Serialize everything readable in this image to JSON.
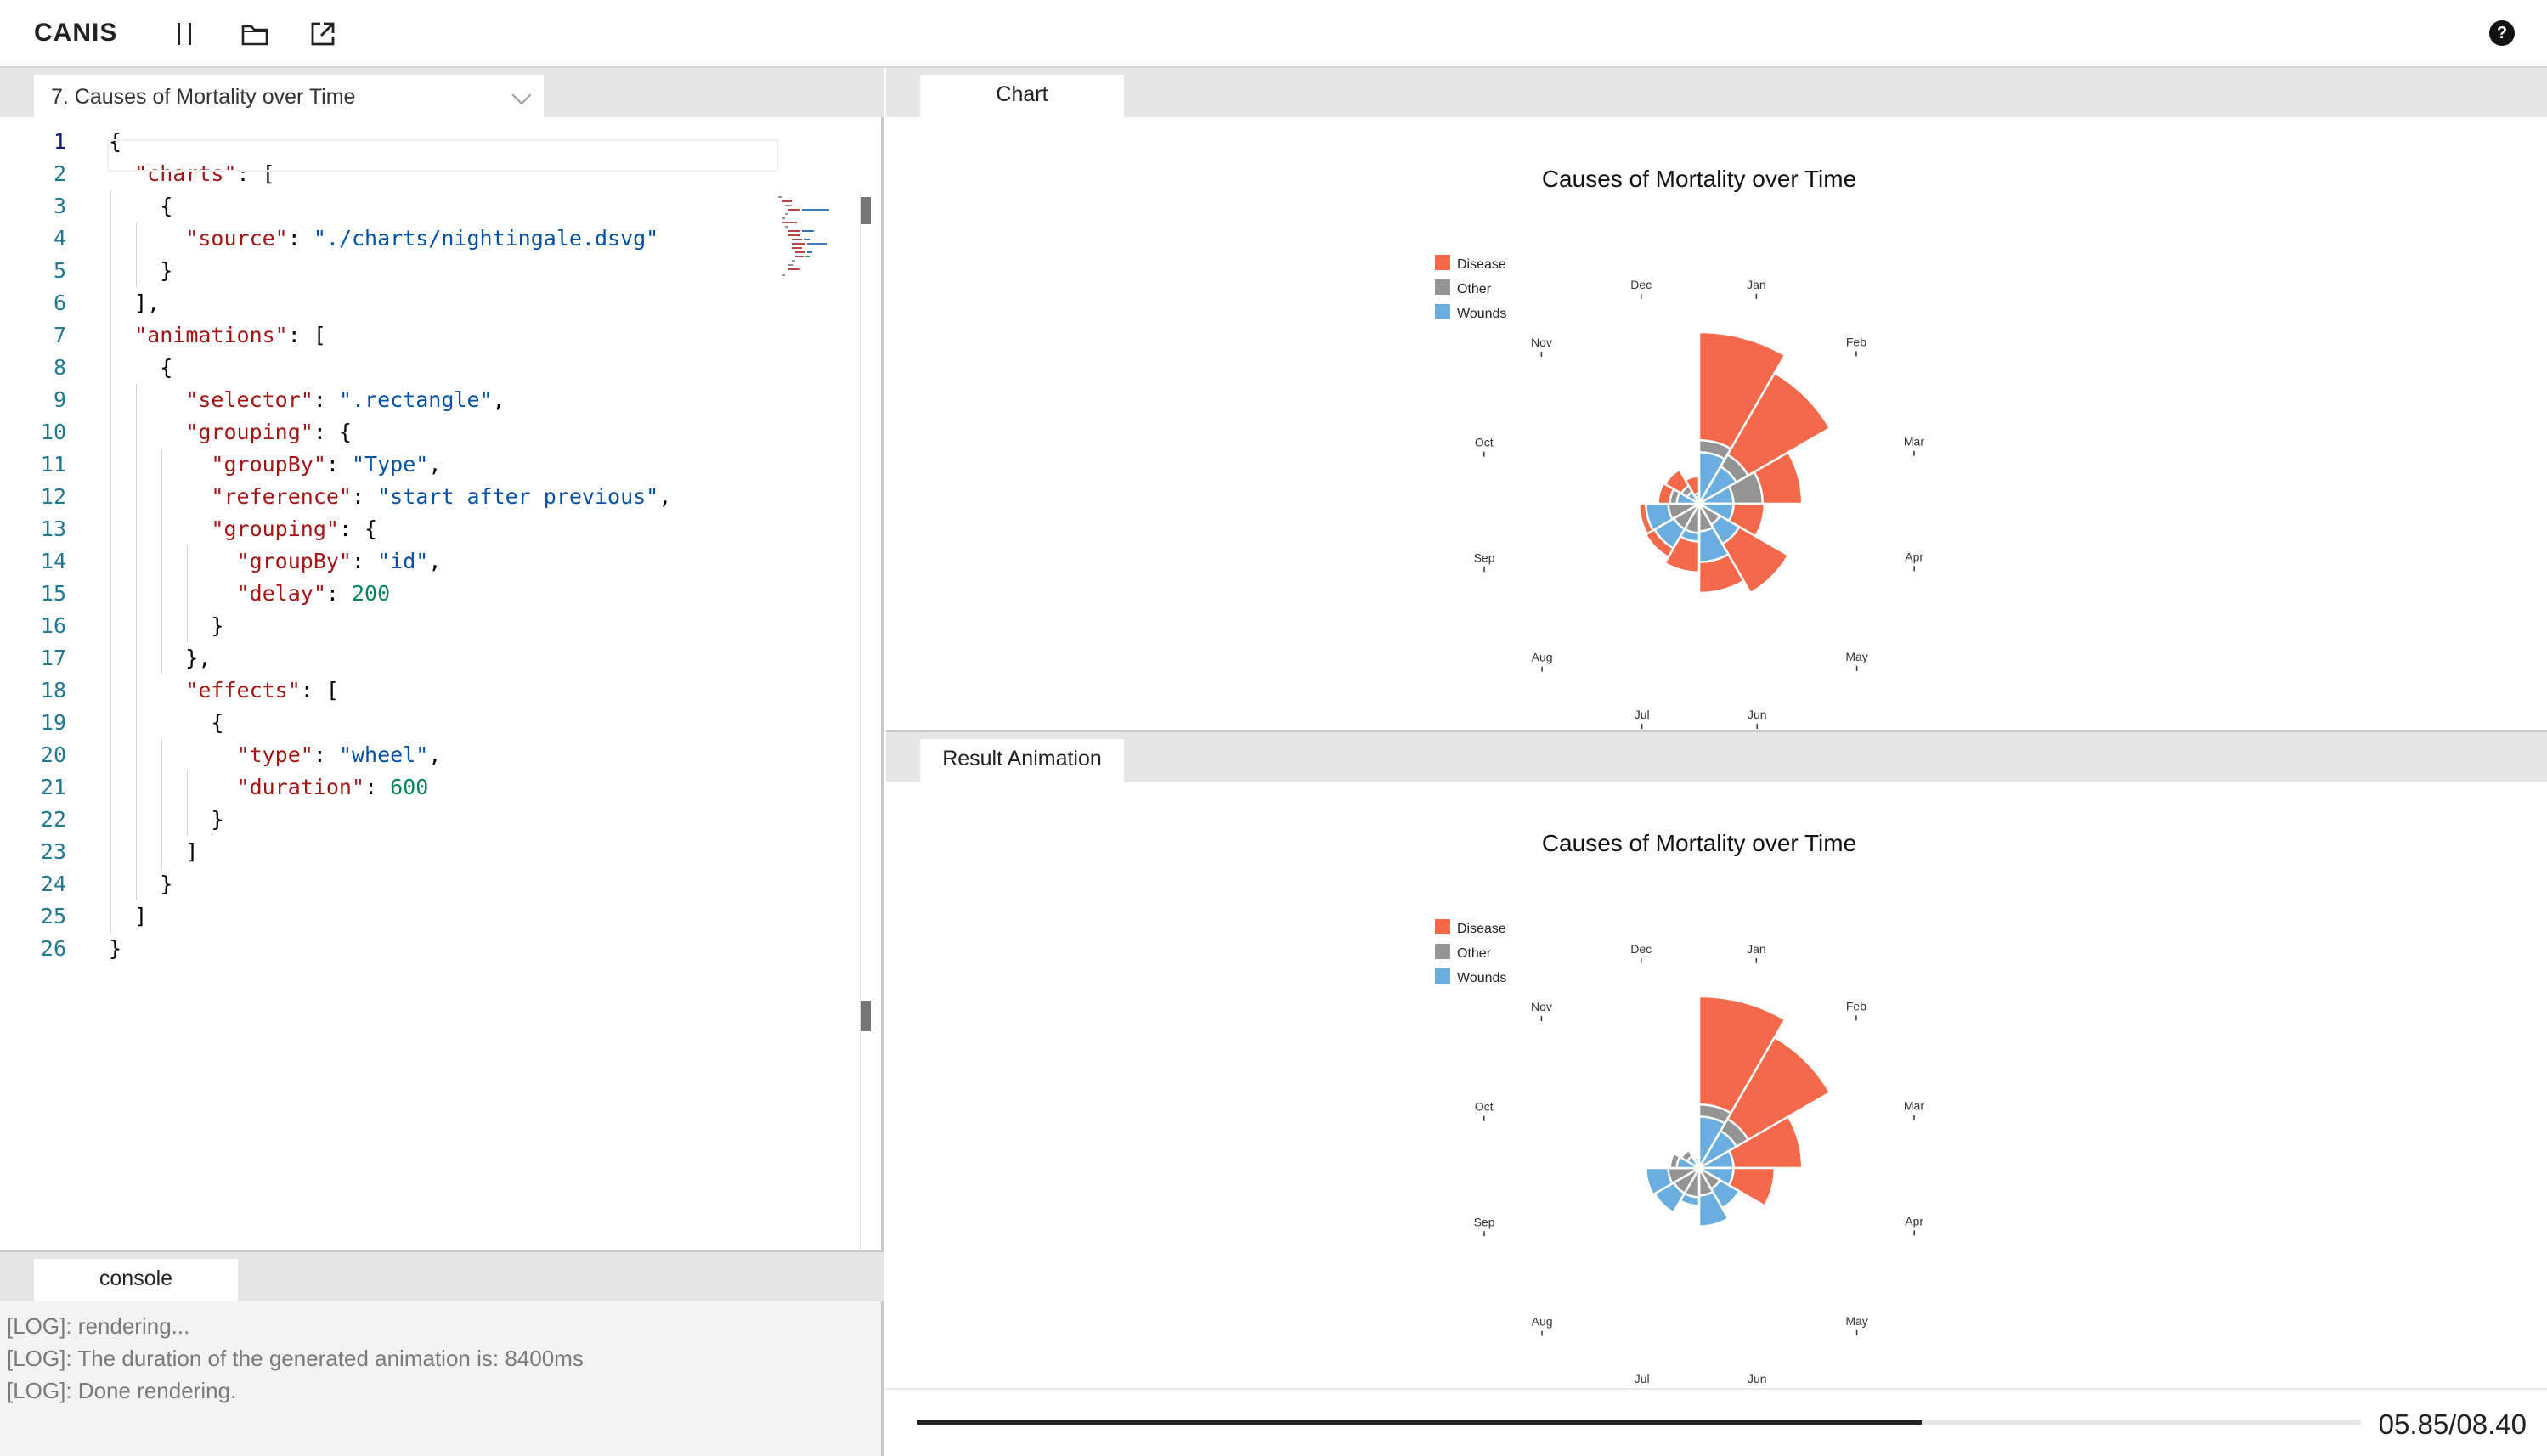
{
  "app": {
    "title": "CANIS"
  },
  "toolbar": {
    "icons": [
      "pause-icon",
      "folder-icon",
      "export-icon"
    ],
    "help": "?"
  },
  "editor": {
    "selected_example": "7. Causes of Mortality over Time",
    "lines": [
      [
        [
          "p",
          "{"
        ]
      ],
      [
        [
          "p",
          "  "
        ],
        [
          "k",
          "\"charts\""
        ],
        [
          "p",
          ": ["
        ]
      ],
      [
        [
          "p",
          "    {"
        ]
      ],
      [
        [
          "p",
          "      "
        ],
        [
          "k",
          "\"source\""
        ],
        [
          "p",
          ": "
        ],
        [
          "s",
          "\"./charts/nightingale.dsvg\""
        ]
      ],
      [
        [
          "p",
          "    }"
        ]
      ],
      [
        [
          "p",
          "  ],"
        ]
      ],
      [
        [
          "p",
          "  "
        ],
        [
          "k",
          "\"animations\""
        ],
        [
          "p",
          ": ["
        ]
      ],
      [
        [
          "p",
          "    {"
        ]
      ],
      [
        [
          "p",
          "      "
        ],
        [
          "k",
          "\"selector\""
        ],
        [
          "p",
          ": "
        ],
        [
          "s",
          "\".rectangle\""
        ],
        [
          "p",
          ","
        ]
      ],
      [
        [
          "p",
          "      "
        ],
        [
          "k",
          "\"grouping\""
        ],
        [
          "p",
          ": {"
        ]
      ],
      [
        [
          "p",
          "        "
        ],
        [
          "k",
          "\"groupBy\""
        ],
        [
          "p",
          ": "
        ],
        [
          "s",
          "\"Type\""
        ],
        [
          "p",
          ","
        ]
      ],
      [
        [
          "p",
          "        "
        ],
        [
          "k",
          "\"reference\""
        ],
        [
          "p",
          ": "
        ],
        [
          "s",
          "\"start after previous\""
        ],
        [
          "p",
          ","
        ]
      ],
      [
        [
          "p",
          "        "
        ],
        [
          "k",
          "\"grouping\""
        ],
        [
          "p",
          ": {"
        ]
      ],
      [
        [
          "p",
          "          "
        ],
        [
          "k",
          "\"groupBy\""
        ],
        [
          "p",
          ": "
        ],
        [
          "s",
          "\"id\""
        ],
        [
          "p",
          ","
        ]
      ],
      [
        [
          "p",
          "          "
        ],
        [
          "k",
          "\"delay\""
        ],
        [
          "p",
          ": "
        ],
        [
          "n",
          "200"
        ]
      ],
      [
        [
          "p",
          "        }"
        ]
      ],
      [
        [
          "p",
          "      },"
        ]
      ],
      [
        [
          "p",
          "      "
        ],
        [
          "k",
          "\"effects\""
        ],
        [
          "p",
          ": ["
        ]
      ],
      [
        [
          "p",
          "        {"
        ]
      ],
      [
        [
          "p",
          "          "
        ],
        [
          "k",
          "\"type\""
        ],
        [
          "p",
          ": "
        ],
        [
          "s",
          "\"wheel\""
        ],
        [
          "p",
          ","
        ]
      ],
      [
        [
          "p",
          "          "
        ],
        [
          "k",
          "\"duration\""
        ],
        [
          "p",
          ": "
        ],
        [
          "n",
          "600"
        ]
      ],
      [
        [
          "p",
          "        }"
        ]
      ],
      [
        [
          "p",
          "      ]"
        ]
      ],
      [
        [
          "p",
          "    }"
        ]
      ],
      [
        [
          "p",
          "  ]"
        ]
      ],
      [
        [
          "p",
          "}"
        ]
      ]
    ]
  },
  "console": {
    "tab_label": "console",
    "logs": [
      "[LOG]: rendering...",
      "[LOG]: The duration of the generated animation is: 8400ms",
      "[LOG]: Done rendering."
    ]
  },
  "chart_panel": {
    "tab_label": "Chart"
  },
  "animation_panel": {
    "tab_label": "Result Animation"
  },
  "playback": {
    "time": "05.85/08.40",
    "progress": 0.696
  },
  "colors": {
    "Disease": "#f4694a",
    "Other": "#949494",
    "Wounds": "#6aaee0"
  },
  "chart_data": [
    {
      "type": "polar-area",
      "title": "Causes of Mortality over Time",
      "legend": [
        "Disease",
        "Other",
        "Wounds"
      ],
      "months": [
        "Jan",
        "Feb",
        "Mar",
        "Apr",
        "May",
        "Jun",
        "Jul",
        "Aug",
        "Sep",
        "Oct",
        "Nov",
        "Dec"
      ],
      "radial": {
        "Disease": [
          1.0,
          0.88,
          0.6,
          0.38,
          0.6,
          0.52,
          0.4,
          0.36,
          0.35,
          0.24,
          0.23,
          0.16
        ],
        "Other": [
          0.37,
          0.33,
          0.37,
          0.2,
          0.14,
          0.16,
          0.17,
          0.17,
          0.18,
          0.17,
          0.12,
          0.06
        ],
        "Wounds": [
          0.3,
          0.25,
          0.2,
          0.2,
          0.27,
          0.34,
          0.22,
          0.3,
          0.31,
          0.13,
          0.08,
          0.04
        ]
      }
    },
    {
      "type": "polar-area",
      "title": "Causes of Mortality over Time",
      "legend": [
        "Disease",
        "Other",
        "Wounds"
      ],
      "months": [
        "Jan",
        "Feb",
        "Mar",
        "Apr",
        "May",
        "Jun",
        "Jul",
        "Aug",
        "Sep",
        "Oct",
        "Nov",
        "Dec"
      ],
      "radial": {
        "Disease": [
          1.0,
          0.88,
          0.6,
          0.44,
          0,
          0,
          0,
          0,
          0,
          0,
          0,
          0
        ],
        "Other": [
          0.37,
          0.33,
          0.2,
          0.2,
          0.14,
          0.16,
          0.17,
          0.17,
          0.18,
          0.17,
          0.12,
          0.06
        ],
        "Wounds": [
          0.3,
          0.25,
          0.2,
          0.2,
          0.27,
          0.34,
          0.22,
          0.3,
          0.31,
          0.13,
          0.08,
          0.04
        ]
      }
    }
  ]
}
